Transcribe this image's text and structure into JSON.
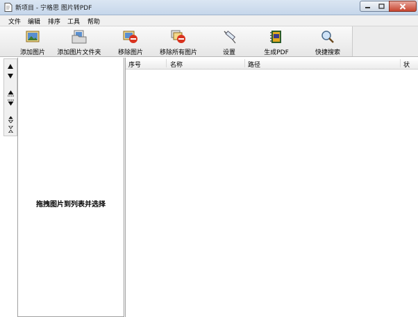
{
  "window": {
    "title": "新项目 - 宁格思 图片转PDF"
  },
  "menu": [
    "文件",
    "编辑",
    "排序",
    "工具",
    "帮助"
  ],
  "toolbar": {
    "add_image": "添加图片",
    "add_folder": "添加图片文件夹",
    "remove_image": "移除图片",
    "remove_all": "移除所有图片",
    "settings": "设置",
    "generate_pdf": "生成PDF",
    "quick_search": "快捷搜索"
  },
  "drop_hint": "拖拽图片到列表并选择",
  "table": {
    "columns": [
      "序号",
      "名称",
      "路径",
      "状"
    ]
  },
  "icons": {
    "add_image": "picture-icon",
    "add_folder": "folder-picture-icon",
    "remove_image": "picture-remove-icon",
    "remove_all": "pictures-remove-icon",
    "settings": "syringe-icon",
    "generate_pdf": "pdf-book-icon",
    "quick_search": "magnifier-icon"
  },
  "colors": {
    "titlebar": "#c5d6ea",
    "close_button": "#c7442f",
    "remove_badge": "#d9331f"
  }
}
